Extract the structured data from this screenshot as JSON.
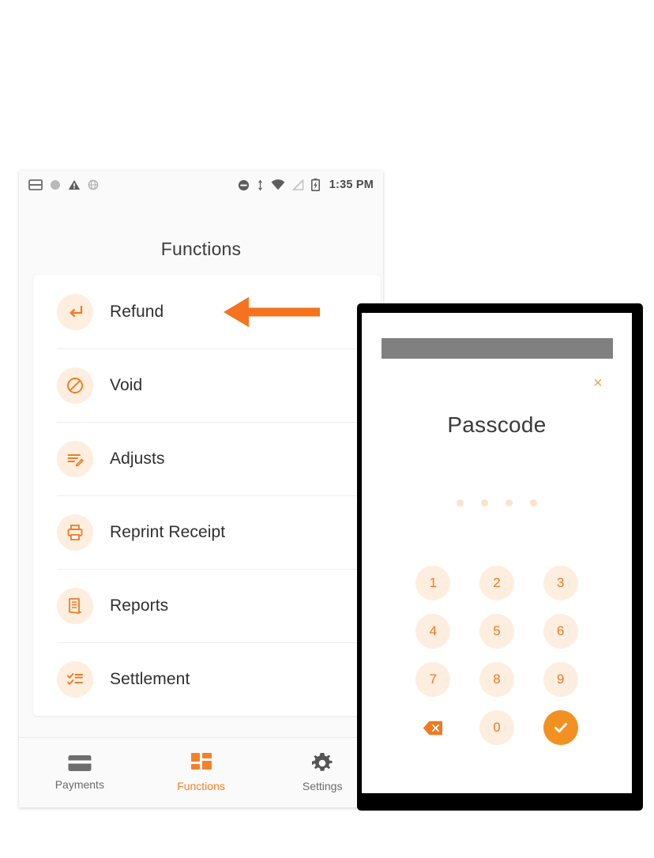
{
  "phone": {
    "status_bar": {
      "time": "1:35 PM",
      "left_icons": [
        "sim-card-icon",
        "circle-dot-icon",
        "warning-triangle-icon",
        "globe-sync-icon"
      ],
      "right_icons": [
        "do-not-disturb-icon",
        "data-transfer-icon",
        "wifi-icon",
        "signal-off-icon",
        "battery-charging-icon"
      ]
    },
    "title": "Functions",
    "functions": [
      {
        "label": "Refund",
        "icon": "return-arrow-icon"
      },
      {
        "label": "Void",
        "icon": "circle-slash-icon"
      },
      {
        "label": "Adjusts",
        "icon": "edit-lines-icon"
      },
      {
        "label": "Reprint Receipt",
        "icon": "printer-icon"
      },
      {
        "label": "Reports",
        "icon": "report-document-icon"
      },
      {
        "label": "Settlement",
        "icon": "checklist-icon"
      }
    ],
    "bottom_nav": [
      {
        "label": "Payments",
        "icon": "credit-card-icon",
        "active": false
      },
      {
        "label": "Functions",
        "icon": "grid-squares-icon",
        "active": true
      },
      {
        "label": "Settings",
        "icon": "gear-icon",
        "active": false
      }
    ]
  },
  "annotation": {
    "arrow": "left-pointing-arrow",
    "color": "#F4731C",
    "points_to": "Refund"
  },
  "passcode_dialog": {
    "redacted_bar": "",
    "close_label": "×",
    "title": "Passcode",
    "dots_total": 4,
    "dots_filled": 0,
    "keys": [
      {
        "label": "1",
        "type": "digit"
      },
      {
        "label": "2",
        "type": "digit"
      },
      {
        "label": "3",
        "type": "digit"
      },
      {
        "label": "4",
        "type": "digit"
      },
      {
        "label": "5",
        "type": "digit"
      },
      {
        "label": "6",
        "type": "digit"
      },
      {
        "label": "7",
        "type": "digit"
      },
      {
        "label": "8",
        "type": "digit"
      },
      {
        "label": "9",
        "type": "digit"
      },
      {
        "label": "",
        "type": "backspace"
      },
      {
        "label": "0",
        "type": "digit"
      },
      {
        "label": "",
        "type": "confirm"
      }
    ]
  },
  "colors": {
    "accent_orange": "#F4812A",
    "accent_orange_strong": "#EE7A22",
    "icon_tint_bg": "#FDEEDF",
    "text_dark": "#2F2F2F",
    "text_muted": "#6B6B6B",
    "redaction_gray": "#808080"
  }
}
